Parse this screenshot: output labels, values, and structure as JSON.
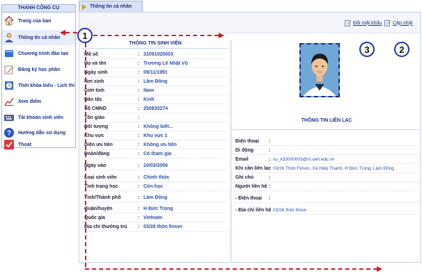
{
  "sidebar": {
    "title": "THANH CÔNG CỤ",
    "items": [
      {
        "label": "Trang của bạn",
        "icon": "home-icon"
      },
      {
        "label": "Thông tin cá nhân",
        "icon": "person-icon"
      },
      {
        "label": "Chương trình đào tạo",
        "icon": "book-icon"
      },
      {
        "label": "Đăng ký học phần",
        "icon": "pen-icon"
      },
      {
        "label": "Thời khóa biểu - Lịch thi",
        "icon": "clock-icon"
      },
      {
        "label": "Xem điểm",
        "icon": "chart-icon"
      },
      {
        "label": "Tài khoản sinh viên",
        "icon": "keyboard-icon"
      },
      {
        "label": "Hướng dẫn sử dụng",
        "icon": "help-icon"
      },
      {
        "label": "Thoát",
        "icon": "exit-icon"
      }
    ]
  },
  "tab": {
    "label": "Thông tin cá nhân"
  },
  "toolbar": {
    "change_password": "Đổi mật khẩu",
    "update": "Cập nhật"
  },
  "student": {
    "title": "THÔNG TIN SINH VIÊN",
    "fields": [
      {
        "label": "Mã số",
        "value": "31091020003"
      },
      {
        "label": "Họ và tên",
        "value": "Trương Lê Nhật Vũ"
      },
      {
        "label": "Ngày sinh",
        "value": "09/11/1991"
      },
      {
        "label": "Nơi sinh",
        "value": "Lâm Đồng"
      },
      {
        "label": "Giới tính",
        "value": "Nam"
      },
      {
        "label": "Dân tộc",
        "value": "Kinh"
      },
      {
        "label": "Số CMND",
        "value": "250820274"
      },
      {
        "label": "Tôn giáo",
        "value": ""
      },
      {
        "label": "Đối tượng",
        "value": "Không biết..."
      },
      {
        "label": "Khu vực",
        "value": "Khu vực 1"
      },
      {
        "label": "Diện ưu tiên",
        "value": "Không ưu tiên"
      },
      {
        "label": "Đoàn/đảng",
        "value": "Có tham gia"
      },
      {
        "label": "Ngày vào",
        "value": "10/03/2006"
      },
      {
        "label": "Loại sinh viên",
        "value": "Chính thức"
      },
      {
        "label": "Tình trạng học",
        "value": "Còn học"
      },
      {
        "label": "Tỉnh/Thành phố",
        "value": "Lâm Đồng"
      },
      {
        "label": "Quận/huyện",
        "value": "H Đức Trọng"
      },
      {
        "label": "Quốc gia",
        "value": "Vietnam"
      },
      {
        "label": "Địa chỉ thường trú",
        "value": "03/26 thôn fimon"
      }
    ]
  },
  "contact": {
    "title": "THÔNG TIN LIÊN LẠC",
    "fields": [
      {
        "label": "Điện thoại",
        "value": ""
      },
      {
        "label": "Di động",
        "value": ""
      },
      {
        "label": "Email",
        "value": "vu_k33000003@st.ueh.edu.vn"
      },
      {
        "label": "Khi cần liên lạc",
        "value": "03/26 Thôn Fimon, Xã Hiệp Thạnh, H Đức Trọng, Lâm Đồng"
      },
      {
        "label": "Ghi chú",
        "value": ""
      },
      {
        "label": "Người liên hệ",
        "value": ""
      },
      {
        "label": "- Điện thoại",
        "value": ""
      },
      {
        "label": "- Địa chỉ liên hệ",
        "value": "03/26 thôn fimon"
      }
    ]
  },
  "annotations": {
    "one": "1",
    "two": "2",
    "three": "3"
  },
  "colors": {
    "accent": "#1b2f8c",
    "value": "#2a4fb0",
    "annotation_arrow": "#d11a1a",
    "annotation_circle": "#1a2fbf"
  }
}
